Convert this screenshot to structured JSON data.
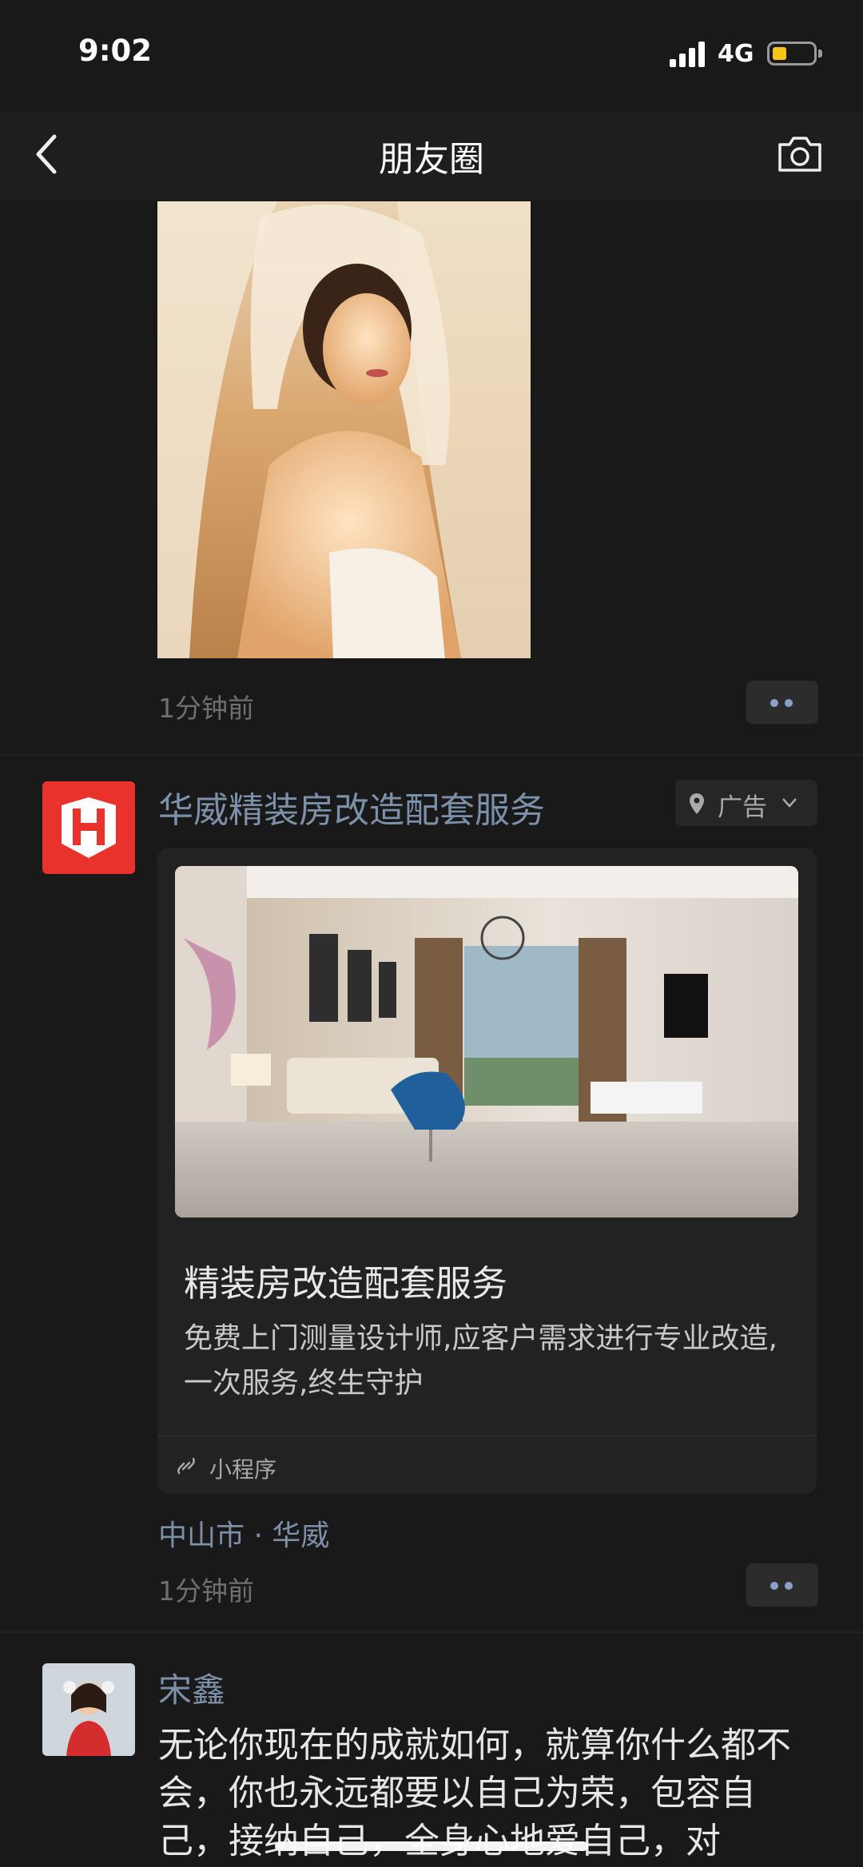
{
  "status_bar": {
    "time": "9:02",
    "network": "4G",
    "battery_level": 0.35
  },
  "nav": {
    "title": "朋友圈"
  },
  "post1": {
    "time": "1分钟前"
  },
  "ad": {
    "name": "华威精装房改造配套服务",
    "tag": "广告",
    "card": {
      "title": "精装房改造配套服务",
      "description": "免费上门测量设计师,应客户需求进行专业改造,一次服务,终生守护",
      "mini_program_label": "小程序"
    },
    "location": "中山市 · 华威",
    "time": "1分钟前"
  },
  "post3": {
    "author": "宋鑫",
    "text": "无论你现在的成就如何，就算你什么都不会，你也永远都要以自己为荣，包容自己，接纳自己，全身心地爱自己，对"
  },
  "colors": {
    "background": "#191919",
    "link_name": "#7d90a9",
    "ad_logo": "#e8322b",
    "battery": "#f5c518"
  },
  "icons": [
    "back-chevron-icon",
    "camera-icon",
    "location-pin-icon",
    "chevron-down-icon",
    "link-icon",
    "signal-icon",
    "battery-icon"
  ]
}
